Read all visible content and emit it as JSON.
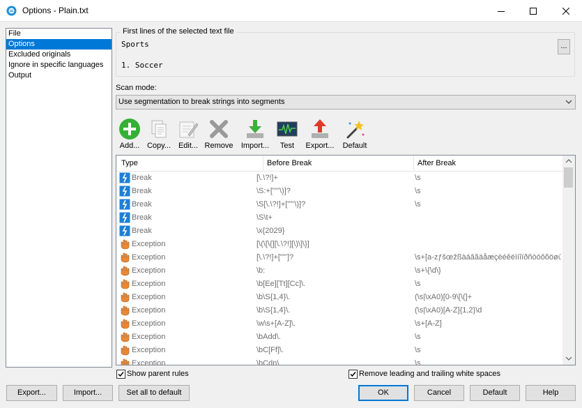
{
  "window": {
    "title": "Options - Plain.txt"
  },
  "sidebar": {
    "items": [
      {
        "label": "File"
      },
      {
        "label": "Options"
      },
      {
        "label": "Excluded originals"
      },
      {
        "label": "Ignore in specific languages"
      },
      {
        "label": "Output"
      }
    ],
    "selected": "Options"
  },
  "preview": {
    "group_label": "First lines of the selected text file",
    "lines": [
      "Sports",
      "1. Soccer"
    ],
    "browse_label": "..."
  },
  "scan_mode": {
    "label": "Scan mode:",
    "value": "Use segmentation to break strings into segments"
  },
  "toolbar": {
    "add": "Add...",
    "copy": "Copy...",
    "edit": "Edit...",
    "remove": "Remove",
    "import": "Import...",
    "test": "Test",
    "export": "Export...",
    "default": "Default"
  },
  "grid": {
    "columns": [
      "Type",
      "Before Break",
      "After Break"
    ],
    "rows": [
      {
        "type": "Break",
        "icon": "break-icon",
        "before": "[\\.\\?!]+",
        "after": "\\s"
      },
      {
        "type": "Break",
        "icon": "break-icon",
        "before": "\\S:+[\"”’\\)]?",
        "after": "\\s"
      },
      {
        "type": "Break",
        "icon": "break-icon",
        "before": "\\S[\\.\\?!]+[\"”’\\)]?",
        "after": "\\s"
      },
      {
        "type": "Break",
        "icon": "break-icon",
        "before": "\\S\\t+",
        "after": ""
      },
      {
        "type": "Break",
        "icon": "break-icon",
        "before": "\\x{2029}",
        "after": ""
      },
      {
        "type": "Exception",
        "icon": "exception-icon",
        "before": "[\\(\\[\\{][\\.\\?!][\\)\\]\\}]",
        "after": ""
      },
      {
        "type": "Exception",
        "icon": "exception-icon",
        "before": "[\\.\\?!]+[\"”’]?",
        "after": "\\s+[a-zƒšœžßàáâãäåæçèéêëìíîïðñòóôõöøùúû"
      },
      {
        "type": "Exception",
        "icon": "exception-icon",
        "before": "\\b:",
        "after": "\\s+\\{\\d\\}"
      },
      {
        "type": "Exception",
        "icon": "exception-icon",
        "before": "\\b[Ee][Tt][Cc]\\.",
        "after": "\\s"
      },
      {
        "type": "Exception",
        "icon": "exception-icon",
        "before": "\\b\\S{1,4}\\.",
        "after": "(\\s|\\xA0)[0-9\\[\\(]+"
      },
      {
        "type": "Exception",
        "icon": "exception-icon",
        "before": "\\b\\S{1,4}\\.",
        "after": "(\\s|\\xA0)[A-Z]{1,2}\\d"
      },
      {
        "type": "Exception",
        "icon": "exception-icon",
        "before": "\\w\\s+[A-Z]\\.",
        "after": "\\s+[A-Z]"
      },
      {
        "type": "Exception",
        "icon": "exception-icon",
        "before": "\\bAdd\\.",
        "after": "\\s"
      },
      {
        "type": "Exception",
        "icon": "exception-icon",
        "before": "\\bC[Ff]\\.",
        "after": "\\s"
      },
      {
        "type": "Exception",
        "icon": "exception-icon",
        "before": "\\bCdn\\.",
        "after": "\\s"
      }
    ]
  },
  "options": {
    "show_parent_rules": {
      "label": "Show parent rules",
      "checked": true
    },
    "remove_whitespace": {
      "label": "Remove leading and trailing white spaces",
      "checked": true
    }
  },
  "buttons": {
    "export": "Export...",
    "import": "Import...",
    "set_all_default": "Set all to default",
    "ok": "OK",
    "cancel": "Cancel",
    "default": "Default",
    "help": "Help"
  },
  "colors": {
    "accent": "#0078d7",
    "break_icon": "#1e7fd6",
    "exception_icon": "#e8883a"
  }
}
